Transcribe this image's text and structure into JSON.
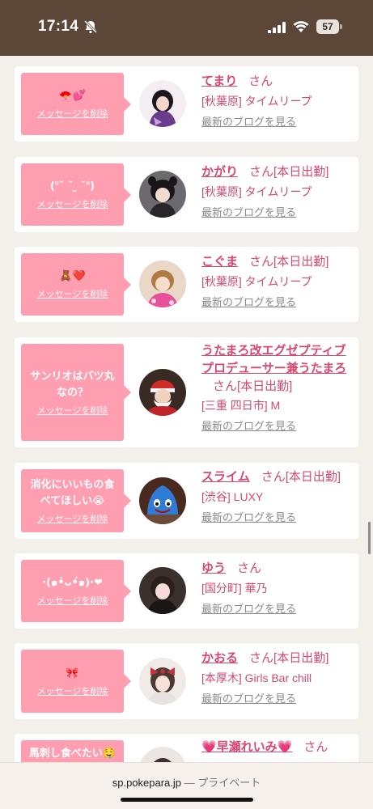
{
  "status_bar": {
    "time": "17:14",
    "battery": "57"
  },
  "delete_label": "メッセージを削除",
  "blog_label": "最新のブログを見る",
  "san": "さん",
  "cards": [
    {
      "msg": "🪭💕",
      "name": "てまり",
      "today": "",
      "shop": "[秋葉原] タイムリープ"
    },
    {
      "msg": "(ᐡ˘ ˘ ̫ ˘ᐡ)",
      "name": "かがり",
      "today": "[本日出勤]",
      "shop": "[秋葉原] タイムリープ"
    },
    {
      "msg": "🧸❤️",
      "name": "こぐま",
      "today": "[本日出勤]",
      "shop": "[秋葉原] タイムリープ"
    },
    {
      "msg": "サンリオはバツ丸なの？",
      "name": "うたまろ改エグゼプティブプロデューサー兼うたまろ",
      "today": "[本日出勤]",
      "shop": "[三重 四日市] M"
    },
    {
      "msg": "消化にいいもの食べてほしい😭",
      "name": "スライム",
      "today": "[本日出勤]",
      "shop": "[渋谷] LUXY"
    },
    {
      "msg": "·(๑•̀ᴗ•́๑)·❤",
      "name": "ゆう",
      "today": "",
      "shop": "[国分町] 華乃"
    },
    {
      "msg": "🎀",
      "name": "かおる",
      "today": "[本日出勤]",
      "shop": "[本厚木] Girls Bar chill"
    },
    {
      "msg": "馬刺し食べたい🤤",
      "name": "💗早瀬れいみ💗",
      "today": "",
      "shop": ""
    }
  ],
  "url_bar": {
    "domain": "sp.pokepara.jp",
    "suffix": "— プライベート"
  }
}
